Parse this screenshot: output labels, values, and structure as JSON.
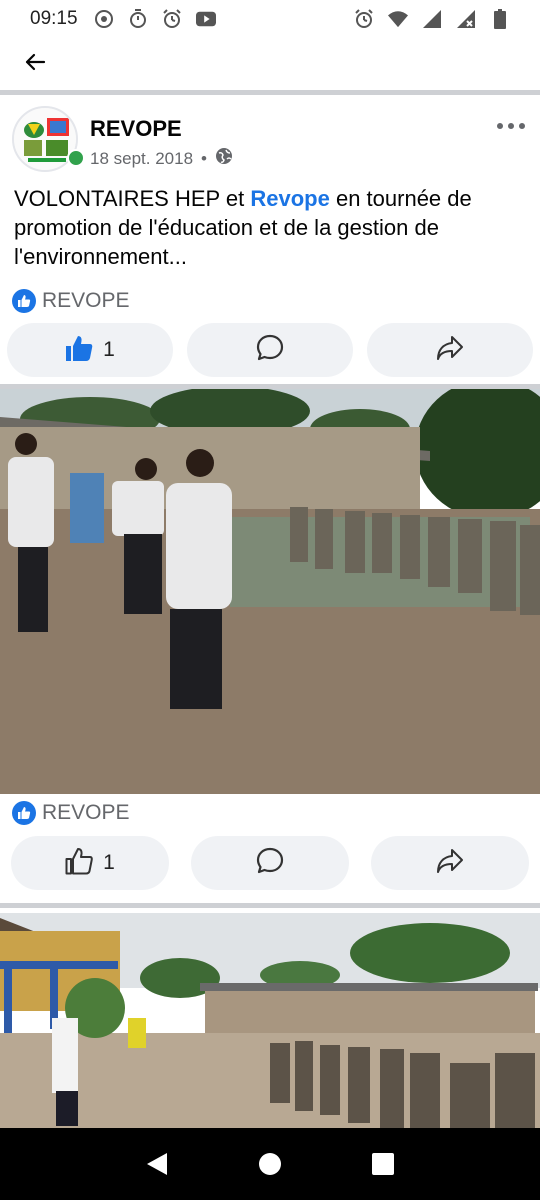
{
  "status_bar": {
    "time": "09:15",
    "left_icons": [
      "chrome-icon",
      "stopwatch-icon",
      "alarm-icon",
      "youtube-icon"
    ],
    "right_icons": [
      "alarm-icon",
      "wifi-icon",
      "signal-icon",
      "signal-x-icon",
      "battery-icon"
    ]
  },
  "topbar": {
    "back_icon": "arrow-left-icon"
  },
  "post": {
    "author": "REVOPE",
    "date": "18 sept. 2018",
    "separator": "•",
    "privacy_icon": "globe-icon",
    "text_before": "VOLONTAIRES HEP et ",
    "mention": "Revope",
    "text_after": " en tournée de promotion de l'éducation et de la gestion de l'environnement...",
    "reaction_name": "REVOPE",
    "like_count": "1",
    "like_icon": "thumbs-up-filled-icon",
    "comment_icon": "comment-icon",
    "share_icon": "share-icon"
  },
  "photo1": {
    "reaction_name": "REVOPE",
    "like_count": "1",
    "like_icon": "thumbs-up-outline-icon"
  },
  "nav": {
    "back": "nav-back-icon",
    "home": "nav-home-icon",
    "recents": "nav-recents-icon"
  },
  "colors": {
    "facebook_blue": "#1b74e4",
    "pill_bg": "#f0f2f5",
    "divider": "#ced0d4",
    "online": "#31a24c"
  }
}
